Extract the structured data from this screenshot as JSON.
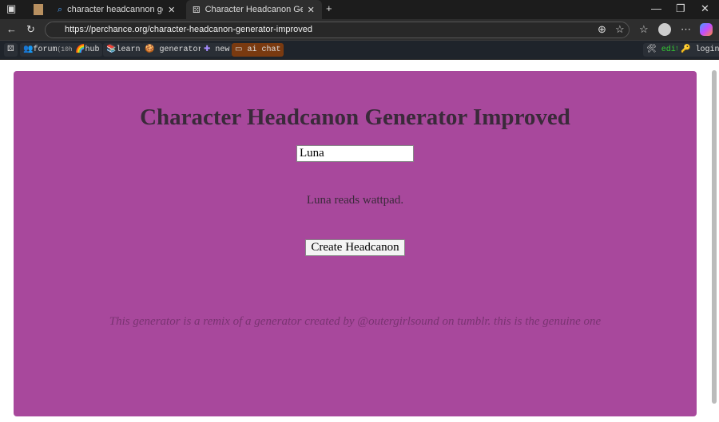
{
  "tabs": [
    {
      "label": "character headcannon generator"
    },
    {
      "label": "Character Headcanon Generator Improved"
    }
  ],
  "address": {
    "url": "https://perchance.org/character-headcanon-generator-improved"
  },
  "bookmarks": {
    "forum": "forum",
    "forum_badge": "(10h)",
    "hub": "hub",
    "learn": "learn",
    "generators": "generators",
    "new": "new",
    "ai_chat": "ai chat",
    "edit": "edit",
    "login": "login"
  },
  "main": {
    "title": "Character Headcanon Generator Improved",
    "name_value": "Luna",
    "output": "Luna reads wattpad.",
    "button": "Create Headcanon",
    "footer": "This generator is a remix of a generator created by @outergirlsound on tumblr. this is the genuine one"
  },
  "colors": {
    "card": "#a8489c"
  }
}
